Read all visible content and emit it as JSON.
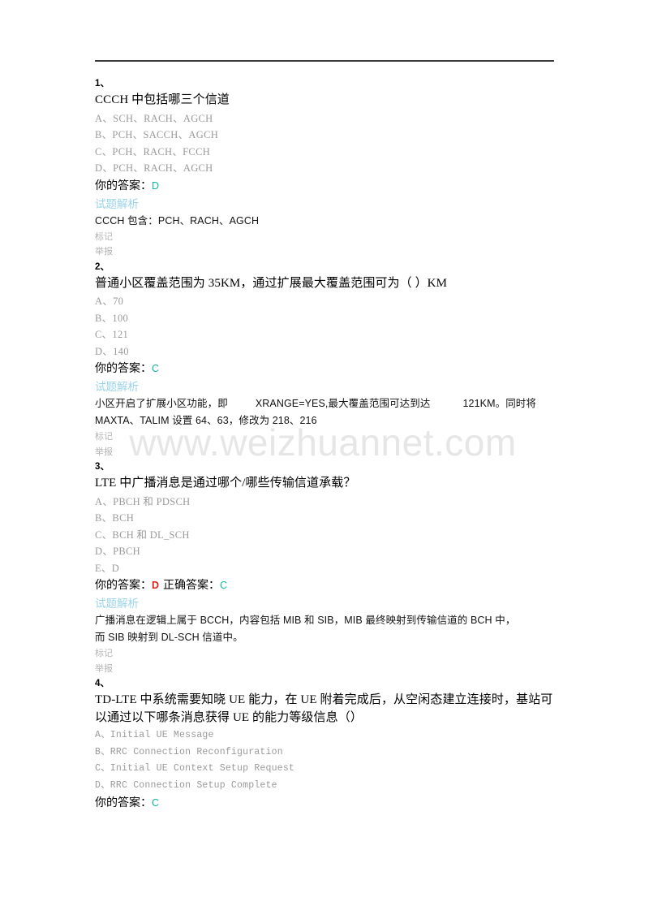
{
  "page": {
    "watermark": "www.weizhuannet.com",
    "colors": {
      "correct_answer": "#13b6a0",
      "wrong_answer": "#e2231a",
      "analysis_label": "#9ad3e8",
      "option_text": "#9a9a9a",
      "foot_link": "#b4b4b4",
      "rule": "#3a3a3a",
      "watermark": "#e6e6e6"
    },
    "labels": {
      "your_answer": "你的答案：",
      "correct_answer": "正确答案：",
      "analysis": "试题解析",
      "mark": "标记",
      "report": "举报"
    }
  },
  "questions": [
    {
      "number": "1、",
      "title": "CCCH 中包括哪三个信道",
      "options": [
        "A、SCH、RACH、AGCH",
        "B、PCH、SACCH、AGCH",
        "C、PCH、RACH、FCCH",
        "D、PCH、RACH、AGCH"
      ],
      "option_style": "serif",
      "your_answer": "D",
      "your_answer_is_wrong": false,
      "show_correct_answer": false,
      "correct_answer": "",
      "analysis_label": "试题解析",
      "analysis_lines": [
        "CCCH 包含：PCH、RACH、AGCH"
      ],
      "mark": "标记",
      "report": "举报"
    },
    {
      "number": "2、",
      "title": "普通小区覆盖范围为 35KM，通过扩展最大覆盖范围可为（ ）KM",
      "options": [
        "A、70",
        "B、100",
        "C、121",
        "D、140"
      ],
      "option_style": "serif",
      "your_answer": "C",
      "your_answer_is_wrong": false,
      "show_correct_answer": false,
      "correct_answer": "",
      "analysis_label": "试题解析",
      "analysis_lines": [
        "小区开启了扩展小区功能，即 XRANGE=YES,最大覆盖范围可达到达 121KM。同时将",
        "MAXTA、TALIM 设置 64、63，修改为 218、216"
      ],
      "analysis_segments": [
        "小区开启了扩展小区功能，即",
        "XRANGE=YES,最大覆盖范围可达到达",
        "121KM。同时将 MAXTA、TALIM 设置 64、63，修改为 218、216"
      ],
      "mark": "标记",
      "report": "举报"
    },
    {
      "number": "3、",
      "title": "LTE 中广播消息是通过哪个/哪些传输信道承载？",
      "options": [
        "A、PBCH 和 PDSCH",
        "B、BCH",
        "C、BCH 和 DL_SCH",
        "D、PBCH",
        "E、D"
      ],
      "option_style": "serif",
      "your_answer": "D",
      "your_answer_is_wrong": true,
      "show_correct_answer": true,
      "correct_answer": "C",
      "analysis_label": "试题解析",
      "analysis_lines": [
        "广播消息在逻辑上属于 BCCH，内容包括 MIB 和 SIB，MIB 最终映射到传输信道的 BCH 中，",
        "而 SIB 映射到 DL-SCH 信道中。"
      ],
      "mark": "标记",
      "report": "举报"
    },
    {
      "number": "4、",
      "title": "TD-LTE 中系统需要知晓 UE 能力，在 UE 附着完成后，从空闲态建立连接时，基站可以通过以下哪条消息获得 UE 的能力等级信息（）",
      "options": [
        "A、Initial UE Message",
        "B、RRC Connection Reconfiguration",
        "C、Initial UE Context Setup Request",
        "D、RRC Connection Setup Complete"
      ],
      "option_style": "mono",
      "your_answer": "C",
      "your_answer_is_wrong": false,
      "show_correct_answer": false,
      "correct_answer": "",
      "analysis_label": "",
      "analysis_lines": [],
      "mark": "",
      "report": ""
    }
  ]
}
